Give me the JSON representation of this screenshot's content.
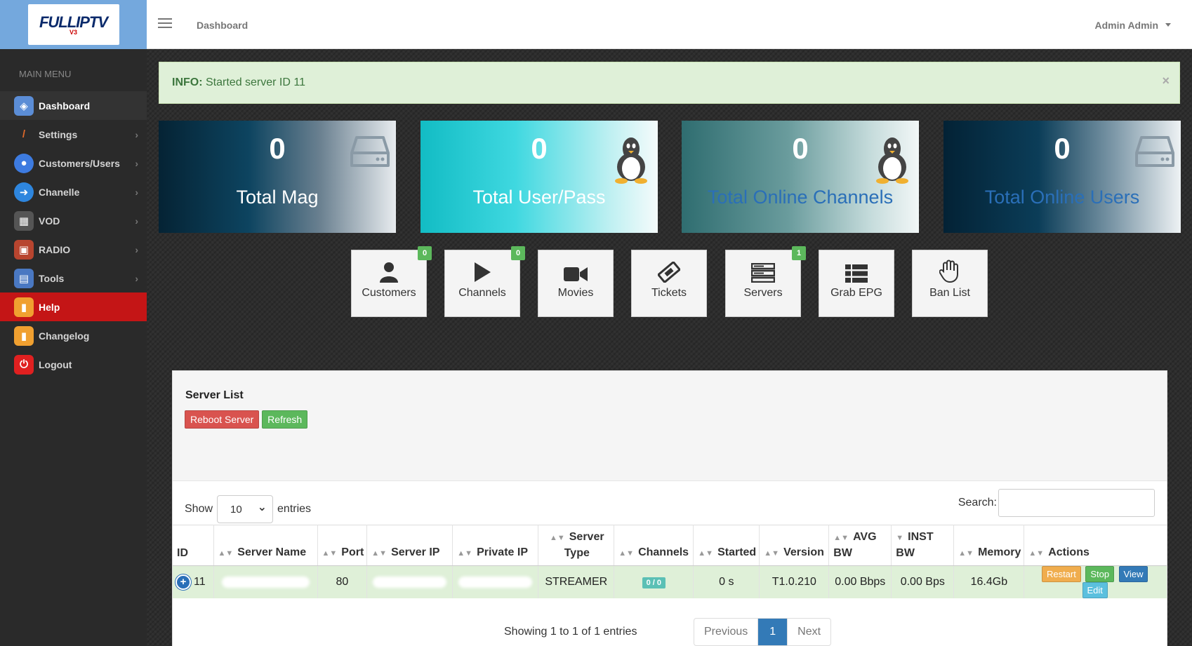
{
  "brand": {
    "logo_main": "FULLIPTV",
    "logo_version": "V3"
  },
  "sidebar": {
    "title": "MAIN MENU",
    "items": [
      {
        "label": "Dashboard",
        "icon": "dashboard-icon",
        "color": "#5b8dd6"
      },
      {
        "label": "Settings",
        "icon": "wrench-icon",
        "color": "#e06a2a"
      },
      {
        "label": "Customers/Users",
        "icon": "users-icon",
        "color": "#3d7be0"
      },
      {
        "label": "Chanelle",
        "icon": "arrow-right-icon",
        "color": "#2e86de"
      },
      {
        "label": "VOD",
        "icon": "clapper-icon",
        "color": "#555555"
      },
      {
        "label": "RADIO",
        "icon": "radio-icon",
        "color": "#b8452f"
      },
      {
        "label": "Tools",
        "icon": "tools-icon",
        "color": "#4a78c2"
      },
      {
        "label": "Help",
        "icon": "book-icon",
        "color": "#f0a030"
      },
      {
        "label": "Changelog",
        "icon": "notes-icon",
        "color": "#f0a030"
      },
      {
        "label": "Logout",
        "icon": "power-icon",
        "color": "#e02020"
      }
    ]
  },
  "topbar": {
    "breadcrumb": "Dashboard",
    "user": "Admin Admin"
  },
  "alert": {
    "prefix": "INFO:",
    "message": "Started server ID 11",
    "close": "×"
  },
  "stats": [
    {
      "value": "0",
      "label": "Total Mag",
      "icon": "hard-drive-icon"
    },
    {
      "value": "0",
      "label": "Total User/Pass",
      "icon": "linux-penguin-icon"
    },
    {
      "value": "0",
      "label": "Total Online Channels",
      "icon": "linux-penguin-icon"
    },
    {
      "value": "0",
      "label": "Total Online Users",
      "icon": "hard-drive-icon"
    }
  ],
  "tiles": [
    {
      "label": "Customers",
      "icon": "user-icon",
      "badge": "0"
    },
    {
      "label": "Channels",
      "icon": "play-icon",
      "badge": "0"
    },
    {
      "label": "Movies",
      "icon": "video-camera-icon",
      "badge": ""
    },
    {
      "label": "Tickets",
      "icon": "ticket-icon",
      "badge": ""
    },
    {
      "label": "Servers",
      "icon": "server-icon",
      "badge": "1"
    },
    {
      "label": "Grab EPG",
      "icon": "list-icon",
      "badge": ""
    },
    {
      "label": "Ban List",
      "icon": "hand-icon",
      "badge": ""
    }
  ],
  "server_list": {
    "title": "Server List",
    "reboot_label": "Reboot Server",
    "refresh_label": "Refresh",
    "show_label": "Show",
    "entries_value": "10",
    "entries_label": "entries",
    "search_label": "Search:",
    "columns": [
      "ID",
      "Server Name",
      "Port",
      "Server IP",
      "Private IP",
      "Server Type",
      "Channels",
      "Started",
      "Version",
      "AVG BW",
      "INST BW",
      "Memory",
      "Actions"
    ],
    "rows": [
      {
        "id": "11",
        "port": "80",
        "type": "STREAMER",
        "channels": "0 / 0",
        "started": "0 s",
        "version": "T1.0.210",
        "avg_bw": "0.00 Bbps",
        "inst_bw": "0.00 Bps",
        "memory": "16.4Gb"
      }
    ],
    "actions": {
      "restart": "Restart",
      "stop": "Stop",
      "view": "View",
      "edit": "Edit"
    },
    "info": "Showing 1 to 1 of 1 entries",
    "pager": {
      "prev": "Previous",
      "page": "1",
      "next": "Next"
    }
  }
}
